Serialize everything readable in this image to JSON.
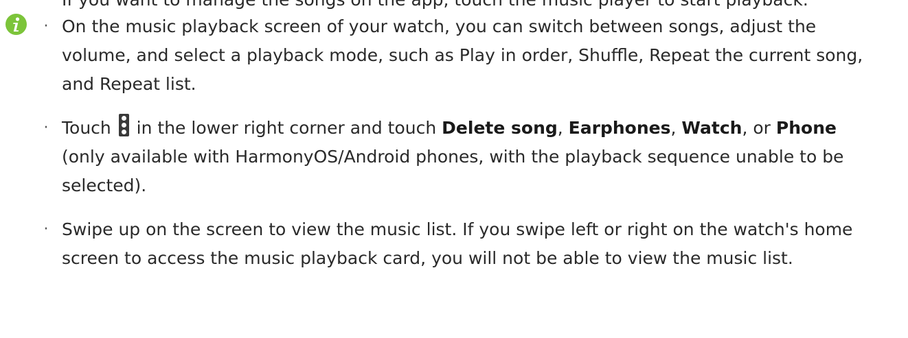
{
  "cut_line": "If you want to manage the songs on the app, touch the music player to start playback.",
  "note": {
    "icon": "info-icon",
    "icon_color": "#7cc43a",
    "items": [
      {
        "text": "On the music playback screen of your watch, you can switch between songs, adjust the volume, and select a playback mode, such as Play in order, Shuffle, Repeat the current song, and Repeat list."
      },
      {
        "before_icon": "Touch",
        "icon": "more-vertical-icon",
        "after_icon": "in the lower right corner and touch",
        "option_1": "Delete song",
        "sep_1": ",",
        "option_2": "Earphones",
        "sep_2": ",",
        "option_3": "Watch",
        "sep_3": ", or",
        "option_4": "Phone",
        "tail": "(only available with HarmonyOS/Android phones, with the playback sequence unable to be selected)."
      },
      {
        "text": "Swipe up on the screen to view the music list. If you swipe left or right on the watch's home screen to access the music playback card, you will not be able to view the music list."
      }
    ]
  }
}
